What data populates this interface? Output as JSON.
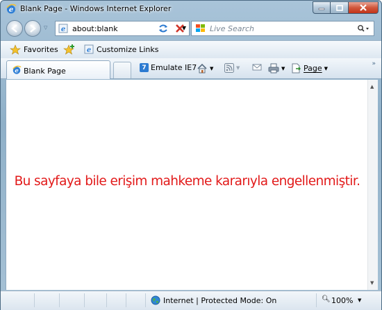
{
  "window": {
    "title": "Blank Page - Windows Internet Explorer"
  },
  "address_bar": {
    "url": "about:blank"
  },
  "search": {
    "placeholder": "Live Search"
  },
  "favorites_bar": {
    "favorites_label": "Favorites",
    "link_label": "Customize Links"
  },
  "tabs": [
    {
      "label": "Blank Page"
    }
  ],
  "command_bar": {
    "emulate_label": "Emulate IE7",
    "page_label": "Page"
  },
  "content": {
    "message": "Bu sayfaya bile erişim mahkeme kararıyla engellenmiştir.",
    "message_color": "#e21a1a"
  },
  "status_bar": {
    "zone": "Internet | Protected Mode: On",
    "zoom": "100%"
  },
  "icons": [
    "ie-logo-icon",
    "back-icon",
    "forward-icon",
    "refresh-icon",
    "stop-icon",
    "live-search-icon",
    "search-icon",
    "star-icon",
    "add-favorite-icon",
    "home-icon",
    "feeds-icon",
    "mail-icon",
    "print-icon",
    "page-icon",
    "globe-icon",
    "zoom-icon"
  ]
}
